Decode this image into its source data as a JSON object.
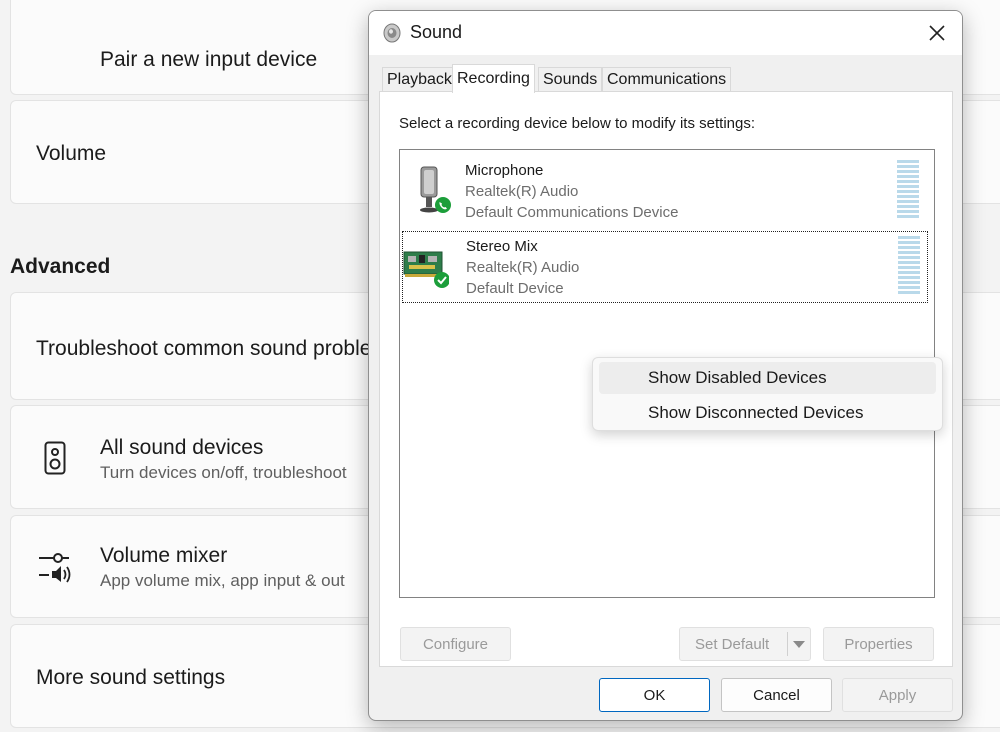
{
  "settings": {
    "pair_input_label": "Pair a new input device",
    "volume_label": "Volume",
    "advanced_heading": "Advanced",
    "troubleshoot_label": "Troubleshoot common sound proble",
    "all_devices": {
      "title": "All sound devices",
      "subtitle": "Turn devices on/off, troubleshoot"
    },
    "mixer": {
      "title": "Volume mixer",
      "subtitle": "App volume mix, app input & out"
    },
    "more_label": "More sound settings"
  },
  "dialog": {
    "title": "Sound",
    "title_icon": "speaker-icon",
    "close_icon": "close-icon",
    "tabs": [
      {
        "label": "Playback",
        "active": false
      },
      {
        "label": "Recording",
        "active": true
      },
      {
        "label": "Sounds",
        "active": false
      },
      {
        "label": "Communications",
        "active": false
      }
    ],
    "instruction": "Select a recording device below to modify its settings:",
    "devices": [
      {
        "name": "Microphone",
        "driver": "Realtek(R) Audio",
        "status": "Default Communications Device",
        "icon": "microphone-icon",
        "badge": "phone-badge-icon"
      },
      {
        "name": "Stereo Mix",
        "driver": "Realtek(R) Audio",
        "status": "Default Device",
        "icon": "sound-card-icon",
        "badge": "checkmark-badge-icon",
        "selected": true
      }
    ],
    "buttons": {
      "configure": "Configure",
      "set_default": "Set Default",
      "properties": "Properties",
      "ok": "OK",
      "cancel": "Cancel",
      "apply": "Apply"
    }
  },
  "context_menu": {
    "items": [
      "Show Disabled Devices",
      "Show Disconnected Devices"
    ]
  },
  "colors": {
    "accent": "#0067c0",
    "badge_green": "#1c9e3a",
    "meter": "#b9d9ea"
  }
}
